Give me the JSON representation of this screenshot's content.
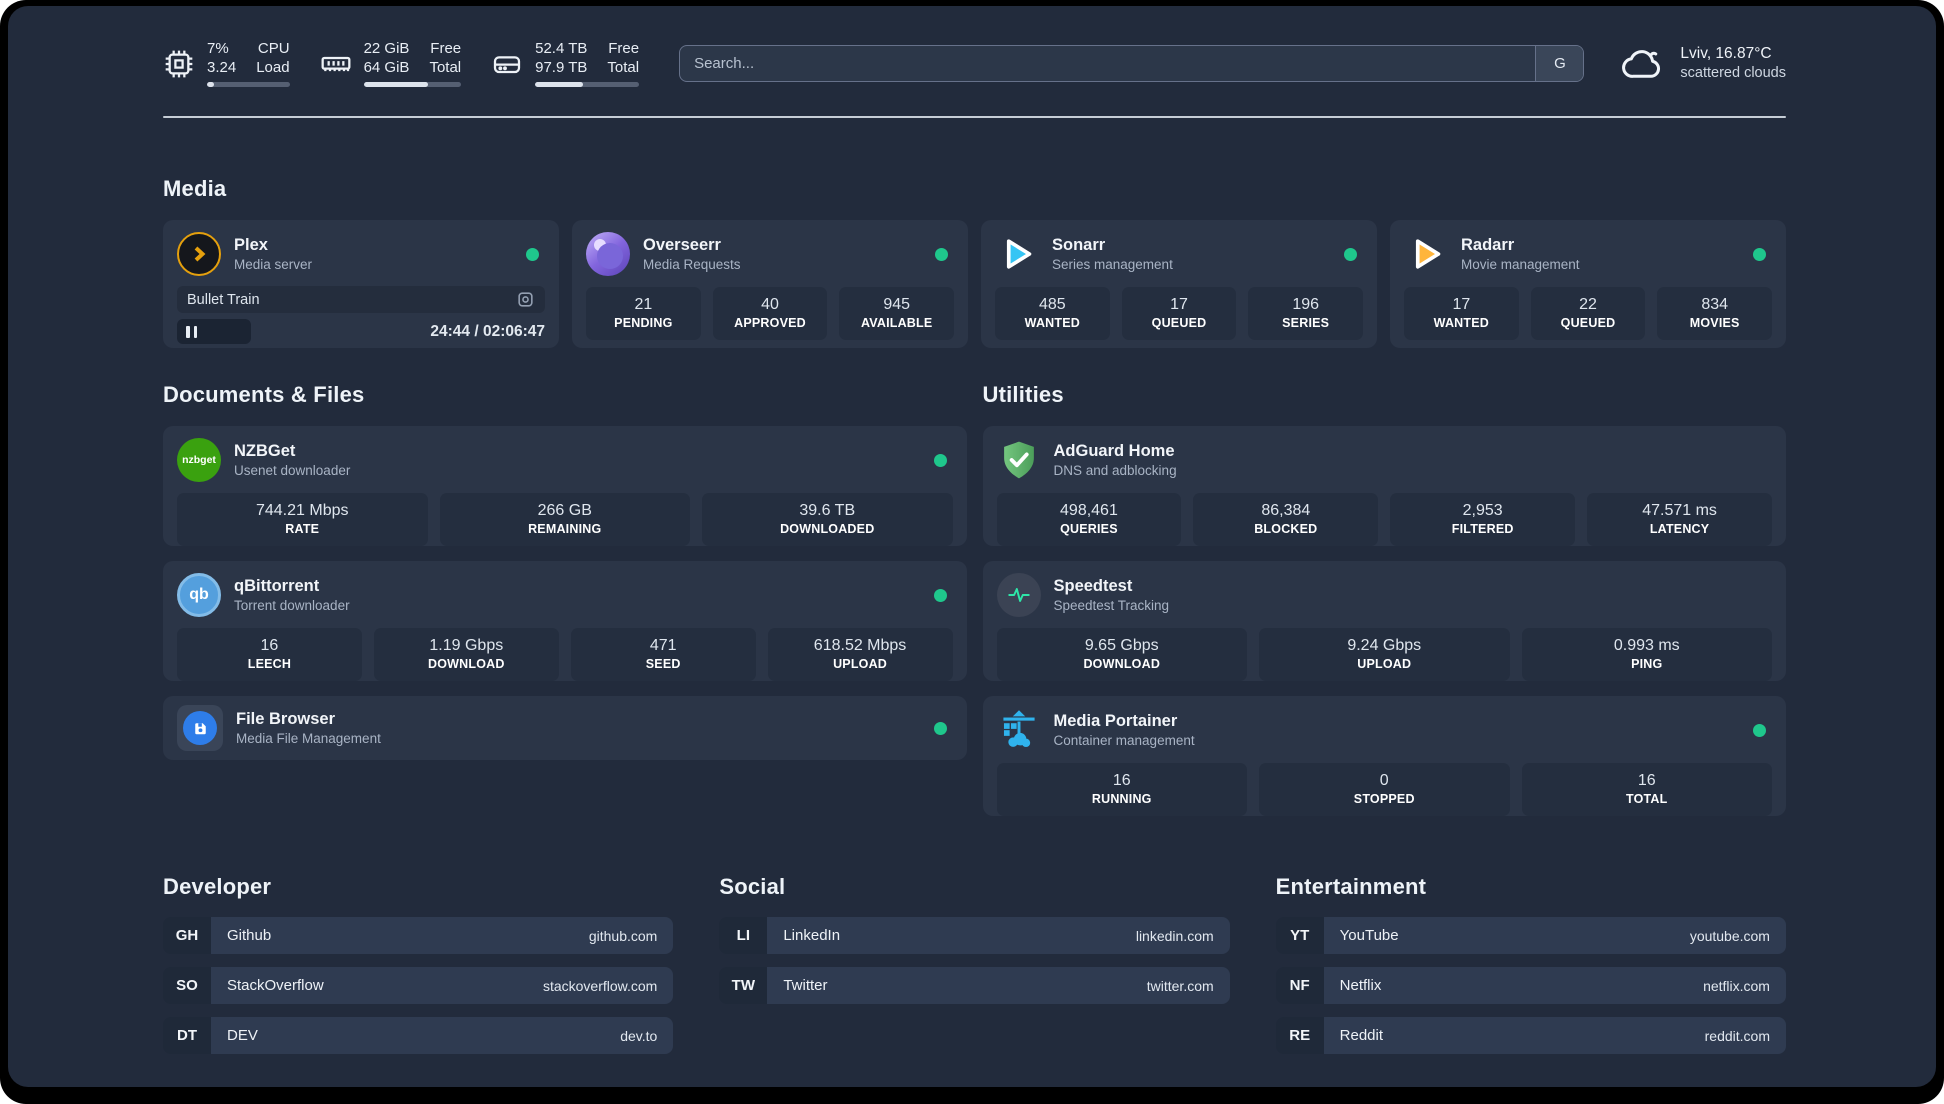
{
  "topbar": {
    "resources": [
      {
        "icon": "cpu-icon",
        "values": [
          "7%",
          "3.24"
        ],
        "labels": [
          "CPU",
          "Load"
        ],
        "progress": 8
      },
      {
        "icon": "ram-icon",
        "values": [
          "22 GiB",
          "64 GiB"
        ],
        "labels": [
          "Free",
          "Total"
        ],
        "progress": 66
      },
      {
        "icon": "disk-icon",
        "values": [
          "52.4 TB",
          "97.9 TB"
        ],
        "labels": [
          "Free",
          "Total"
        ],
        "progress": 46
      }
    ],
    "search": {
      "placeholder": "Search...",
      "provider_label": "G"
    },
    "weather": {
      "icon": "cloud-icon",
      "line1": "Lviv, 16.87°C",
      "line2": "scattered clouds"
    }
  },
  "sections": {
    "media": "Media",
    "documents": "Documents & Files",
    "utilities": "Utilities",
    "developer": "Developer",
    "social": "Social",
    "entertainment": "Entertainment"
  },
  "services": {
    "plex": {
      "name": "Plex",
      "desc": "Media server",
      "icon": "plex-icon",
      "player": {
        "title": "Bullet Train",
        "time": "24:44 / 02:06:47",
        "progress": 20
      }
    },
    "overseerr": {
      "name": "Overseerr",
      "desc": "Media Requests",
      "icon": "overseerr-icon",
      "stats": [
        {
          "value": "21",
          "label": "PENDING"
        },
        {
          "value": "40",
          "label": "APPROVED"
        },
        {
          "value": "945",
          "label": "AVAILABLE"
        }
      ]
    },
    "sonarr": {
      "name": "Sonarr",
      "desc": "Series management",
      "icon": "sonarr-icon",
      "stats": [
        {
          "value": "485",
          "label": "WANTED"
        },
        {
          "value": "17",
          "label": "QUEUED"
        },
        {
          "value": "196",
          "label": "SERIES"
        }
      ]
    },
    "radarr": {
      "name": "Radarr",
      "desc": "Movie management",
      "icon": "radarr-icon",
      "stats": [
        {
          "value": "17",
          "label": "WANTED"
        },
        {
          "value": "22",
          "label": "QUEUED"
        },
        {
          "value": "834",
          "label": "MOVIES"
        }
      ]
    },
    "nzbget": {
      "name": "NZBGet",
      "desc": "Usenet downloader",
      "icon": "nzbget-icon",
      "icon_text": "nzbget",
      "stats": [
        {
          "value": "744.21 Mbps",
          "label": "RATE"
        },
        {
          "value": "266 GB",
          "label": "REMAINING"
        },
        {
          "value": "39.6 TB",
          "label": "DOWNLOADED"
        }
      ]
    },
    "qbittorrent": {
      "name": "qBittorrent",
      "desc": "Torrent downloader",
      "icon": "qbittorrent-icon",
      "icon_text": "qb",
      "stats": [
        {
          "value": "16",
          "label": "LEECH"
        },
        {
          "value": "1.19 Gbps",
          "label": "DOWNLOAD"
        },
        {
          "value": "471",
          "label": "SEED"
        },
        {
          "value": "618.52 Mbps",
          "label": "UPLOAD"
        }
      ]
    },
    "filebrowser": {
      "name": "File Browser",
      "desc": "Media File Management",
      "icon": "filebrowser-icon"
    },
    "adguard": {
      "name": "AdGuard Home",
      "desc": "DNS and adblocking",
      "icon": "adguard-icon",
      "stats": [
        {
          "value": "498,461",
          "label": "QUERIES"
        },
        {
          "value": "86,384",
          "label": "BLOCKED"
        },
        {
          "value": "2,953",
          "label": "FILTERED"
        },
        {
          "value": "47.571 ms",
          "label": "LATENCY"
        }
      ]
    },
    "speedtest": {
      "name": "Speedtest",
      "desc": "Speedtest Tracking",
      "icon": "speedtest-icon",
      "stats": [
        {
          "value": "9.65 Gbps",
          "label": "DOWNLOAD"
        },
        {
          "value": "9.24 Gbps",
          "label": "UPLOAD"
        },
        {
          "value": "0.993 ms",
          "label": "PING"
        }
      ]
    },
    "portainer": {
      "name": "Media Portainer",
      "desc": "Container management",
      "icon": "portainer-icon",
      "stats": [
        {
          "value": "16",
          "label": "RUNNING"
        },
        {
          "value": "0",
          "label": "STOPPED"
        },
        {
          "value": "16",
          "label": "TOTAL"
        }
      ]
    }
  },
  "bookmarks": {
    "developer": [
      {
        "abbr": "GH",
        "name": "Github",
        "url": "github.com"
      },
      {
        "abbr": "SO",
        "name": "StackOverflow",
        "url": "stackoverflow.com"
      },
      {
        "abbr": "DT",
        "name": "DEV",
        "url": "dev.to"
      }
    ],
    "social": [
      {
        "abbr": "LI",
        "name": "LinkedIn",
        "url": "linkedin.com"
      },
      {
        "abbr": "TW",
        "name": "Twitter",
        "url": "twitter.com"
      }
    ],
    "entertainment": [
      {
        "abbr": "YT",
        "name": "YouTube",
        "url": "youtube.com"
      },
      {
        "abbr": "NF",
        "name": "Netflix",
        "url": "netflix.com"
      },
      {
        "abbr": "RE",
        "name": "Reddit",
        "url": "reddit.com"
      }
    ]
  },
  "colors": {
    "background": "#222b3c",
    "card": "#2b3547",
    "stat_tile": "#242e3f",
    "status_online": "#1fc78c",
    "plex_orange": "#e5a00d",
    "sonarr_blue": "#35c5f4",
    "radarr_yellow": "#ffb53c",
    "nzbget_green": "#3aa10f",
    "qbittorrent_blue": "#549fdd",
    "adguard_green": "#66b973",
    "speedtest_green": "#2ee6a8",
    "portainer_blue": "#2fb3ed"
  }
}
